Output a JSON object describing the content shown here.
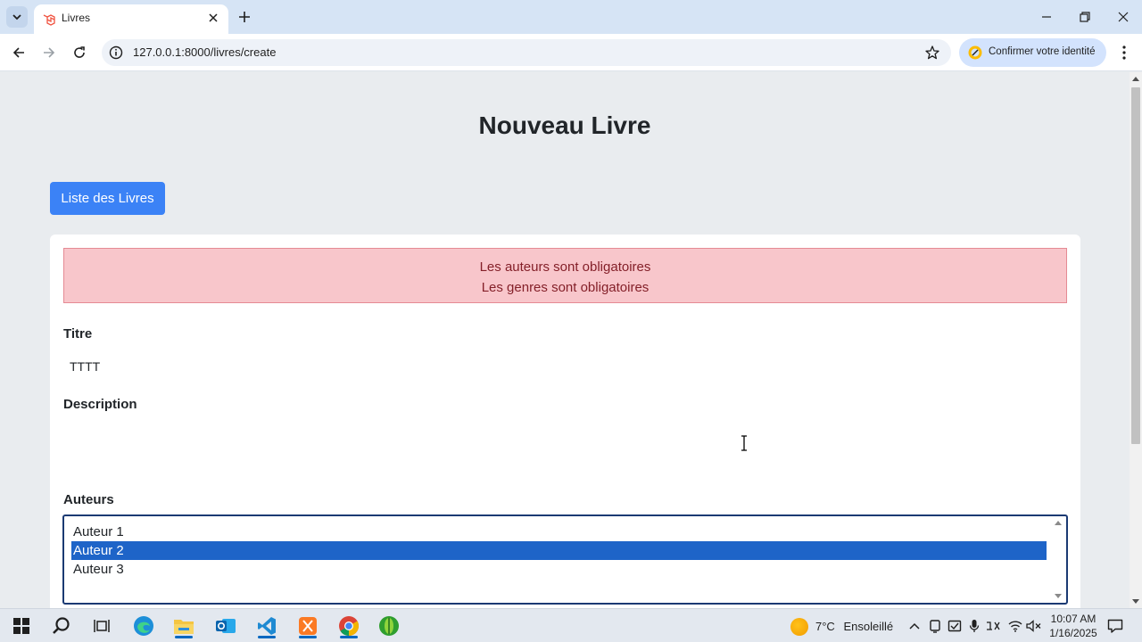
{
  "browser": {
    "tab": {
      "title": "Livres"
    },
    "address": {
      "url": "127.0.0.1:8000/livres/create"
    },
    "identity_button": {
      "label": "Confirmer votre identité"
    }
  },
  "page": {
    "title": "Nouveau Livre",
    "list_button": "Liste des Livres",
    "errors": [
      "Les auteurs sont obligatoires",
      "Les genres sont obligatoires"
    ],
    "form": {
      "titre": {
        "label": "Titre",
        "value": "TTTT"
      },
      "description": {
        "label": "Description",
        "value": ""
      },
      "auteurs": {
        "label": "Auteurs",
        "options": [
          "Auteur 1",
          "Auteur 2",
          "Auteur 3"
        ],
        "selected": "Auteur 2"
      }
    }
  },
  "taskbar": {
    "weather": {
      "temperature": "7°C",
      "condition": "Ensoleillé"
    },
    "clock": {
      "time": "10:07 AM",
      "date": "1/16/2025"
    }
  },
  "colors": {
    "primary_button": "#3b82f6",
    "alert_background": "#f8c6cb",
    "alert_text": "#842029",
    "selected_option": "#1e64c8"
  }
}
